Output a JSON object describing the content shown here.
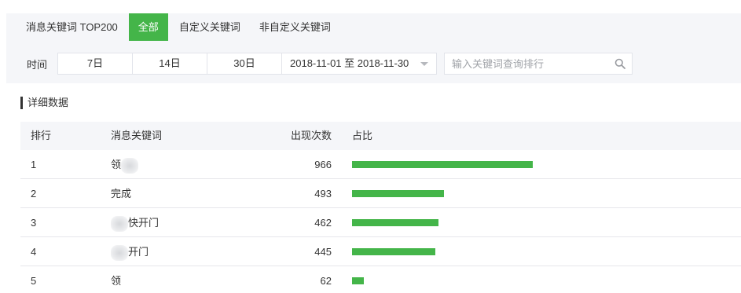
{
  "tabs": [
    {
      "label": "消息关键词 TOP200",
      "active": false
    },
    {
      "label": "全部",
      "active": true
    },
    {
      "label": "自定义关键词",
      "active": false
    },
    {
      "label": "非自定义关键词",
      "active": false
    }
  ],
  "filter": {
    "label": "时间",
    "day_options": [
      "7日",
      "14日",
      "30日"
    ],
    "date_range": "2018-11-01 至 2018-11-30",
    "search_placeholder": "输入关键词查询排行"
  },
  "section_title": "详细数据",
  "table": {
    "headers": [
      "排行",
      "消息关键词",
      "出现次数",
      "占比"
    ],
    "rows": [
      {
        "rank": "1",
        "keyword": "领",
        "count": "966",
        "ratio": 1.0
      },
      {
        "rank": "2",
        "keyword": "完成",
        "count": "493",
        "ratio": 0.5104
      },
      {
        "rank": "3",
        "keyword": "快开门",
        "count": "462",
        "ratio": 0.4783
      },
      {
        "rank": "4",
        "keyword": "开门",
        "count": "445",
        "ratio": 0.4607
      },
      {
        "rank": "5",
        "keyword": "领",
        "count": "62",
        "ratio": 0.0642
      }
    ]
  },
  "colors": {
    "accent": "#44b549",
    "panel": "#f5f6f9"
  }
}
